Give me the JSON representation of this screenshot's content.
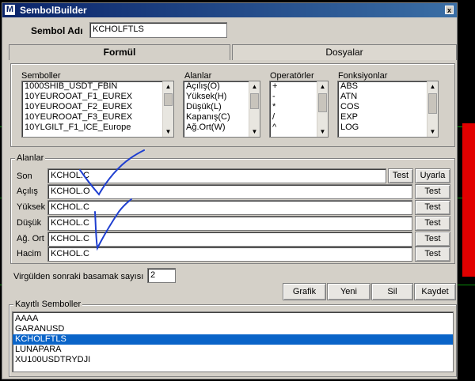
{
  "window": {
    "title": "SembolBuilder",
    "logo_letter": "M",
    "close_glyph": "x"
  },
  "symbol_name": {
    "label": "Sembol Adı",
    "value": "KCHOLFTLS"
  },
  "tabs": [
    {
      "label": "Formül"
    },
    {
      "label": "Dosyalar"
    }
  ],
  "lists": {
    "semboller": {
      "title": "Semboller",
      "items": [
        "1000SHIB_USDT_FBIN",
        "10YEUROOAT_F1_EUREX",
        "10YEUROOAT_F2_EUREX",
        "10YEUROOAT_F3_EUREX",
        "10YLGILT_F1_ICE_Europe"
      ]
    },
    "alanlar": {
      "title": "Alanlar",
      "items": [
        "Açılış(O)",
        "Yüksek(H)",
        "Düşük(L)",
        "Kapanış(C)",
        "Ağ.Ort(W)"
      ]
    },
    "operatorler": {
      "title": "Operatörler",
      "items": [
        "+",
        "-",
        "*",
        "/",
        "^"
      ]
    },
    "fonksiyonlar": {
      "title": "Fonksiyonlar",
      "items": [
        "ABS",
        "ATN",
        "COS",
        "EXP",
        "LOG"
      ]
    }
  },
  "fields_group": {
    "title": "Alanlar",
    "rows": [
      {
        "label": "Son",
        "value": "KCHOL.C",
        "test": "Test",
        "extra": "Uyarla"
      },
      {
        "label": "Açılış",
        "value": "KCHOL.O",
        "test": "Test"
      },
      {
        "label": "Yüksek",
        "value": "KCHOL.C",
        "test": "Test"
      },
      {
        "label": "Düşük",
        "value": "KCHOL.C",
        "test": "Test"
      },
      {
        "label": "Ağ. Ort",
        "value": "KCHOL.C",
        "test": "Test"
      },
      {
        "label": "Hacim",
        "value": "KCHOL.C",
        "test": "Test"
      }
    ]
  },
  "decimal": {
    "label": "Virgülden sonraki basamak sayısı",
    "value": "2"
  },
  "actions": {
    "grafik": "Grafik",
    "yeni": "Yeni",
    "sil": "Sil",
    "kaydet": "Kaydet"
  },
  "saved": {
    "title": "Kayıtlı Semboller",
    "items": [
      "AAAA",
      "GARANUSD",
      "KCHOLFTLS",
      "LUNAPARA",
      "XU100USDTRYDJI"
    ],
    "selected_index": 2
  },
  "colors": {
    "title_bar": "#0a246a",
    "selection": "#0a64c8",
    "annotation_ink": "#1f3fd0",
    "side_bar": "#e10000"
  }
}
